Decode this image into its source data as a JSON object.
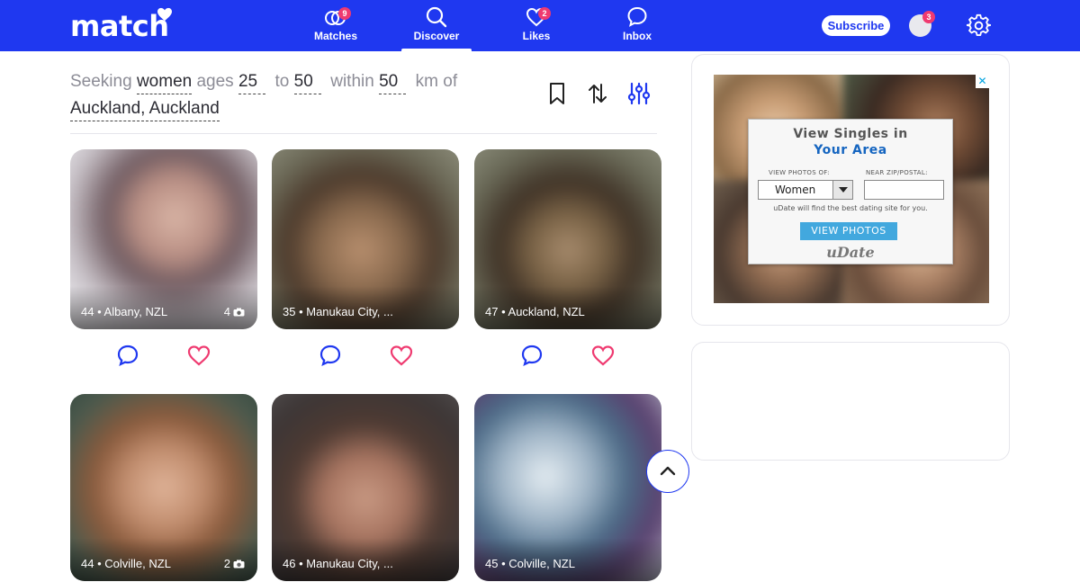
{
  "brand": {
    "logo_text": "match"
  },
  "nav": {
    "items": [
      {
        "label": "Matches",
        "badge": "9"
      },
      {
        "label": "Discover"
      },
      {
        "label": "Likes",
        "badge": "2"
      },
      {
        "label": "Inbox"
      }
    ],
    "active": "Discover",
    "subscribe_label": "Subscribe",
    "profile_badge": "3"
  },
  "search": {
    "seeking_label": "Seeking",
    "gender": "women",
    "ages_label": "ages",
    "age_min": "25",
    "to_label": "to",
    "age_max": "50",
    "within_label": "within",
    "distance": "50",
    "unit_label": "km of",
    "location": "Auckland, Auckland"
  },
  "profiles": [
    {
      "caption": "44 • Albany, NZL",
      "photo_count": "4"
    },
    {
      "caption": "35 • Manukau City, ..."
    },
    {
      "caption": "47 • Auckland, NZL"
    },
    {
      "caption": "44 • Colville, NZL",
      "photo_count": "2"
    },
    {
      "caption": "46 • Manukau City, ..."
    },
    {
      "caption": "45 • Colville, NZL"
    }
  ],
  "ad": {
    "title_line1": "View Singles in",
    "title_line2": "Your Area",
    "photos_of_label": "VIEW PHOTOS OF:",
    "zip_label": "NEAR ZIP/POSTAL:",
    "select_value": "Women",
    "note": "uDate will find the best dating site for you.",
    "button_label": "VIEW PHOTOS",
    "brand": "uDate",
    "close_glyph": "✕"
  },
  "colors": {
    "brand_blue": "#1f38f0",
    "accent_pink": "#ef3a70"
  }
}
